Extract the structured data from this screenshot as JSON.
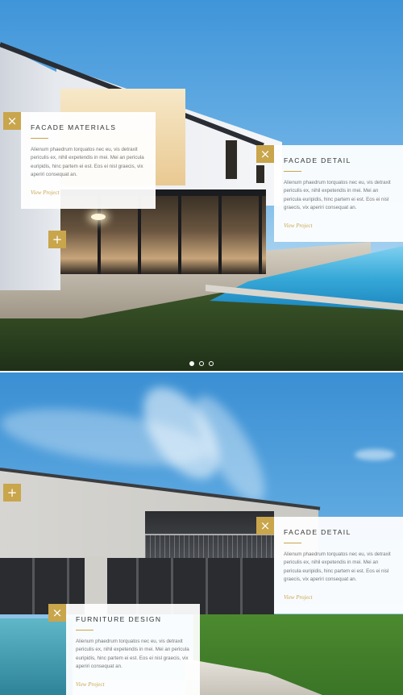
{
  "cards": [
    {
      "title": "FACADE MATERIALS",
      "text": "Alienum phaedrum torquatos nec eu, vis detraxit periculis ex, nihil expetendis in mei. Mei an pericula euripidis, hinc partem ei est. Eos ei nisl graecis, vix aperiri consequat an.",
      "link": "View Project"
    },
    {
      "title": "FACADE DETAIL",
      "text": "Alienum phaedrum torquatos nec eu, vis detraxit periculis ex, nihil expetendis in mei. Mei an pericula euripidis, hinc partem ei est. Eos ei nisl graecis, vix aperiri consequat an.",
      "link": "View Project"
    },
    {
      "title": "FACADE DETAIL",
      "text": "Alienum phaedrum torquatos nec eu, vis detraxit periculis ex, nihil expetendis in mei. Mei an pericula euripidis, hinc partem ei est. Eos ei nisl graecis, vix aperiri consequat an.",
      "link": "View Project"
    },
    {
      "title": "FURNITURE DESIGN",
      "text": "Alienum phaedrum torquatos nec eu, vis detraxit periculis ex, nihil expetendis in mei. Mei an pericula euripidis, hinc partem ei est. Eos ei nisl graecis, vix aperiri consequat an.",
      "link": "View Project"
    }
  ],
  "toggles": {
    "close": "×",
    "plus": "+"
  },
  "slider": {
    "count": 3,
    "active": 1
  },
  "colors": {
    "accent": "#c9a54c",
    "card_bg": "#ffffff"
  },
  "icons": {
    "close": "close-icon",
    "plus": "plus-icon"
  }
}
